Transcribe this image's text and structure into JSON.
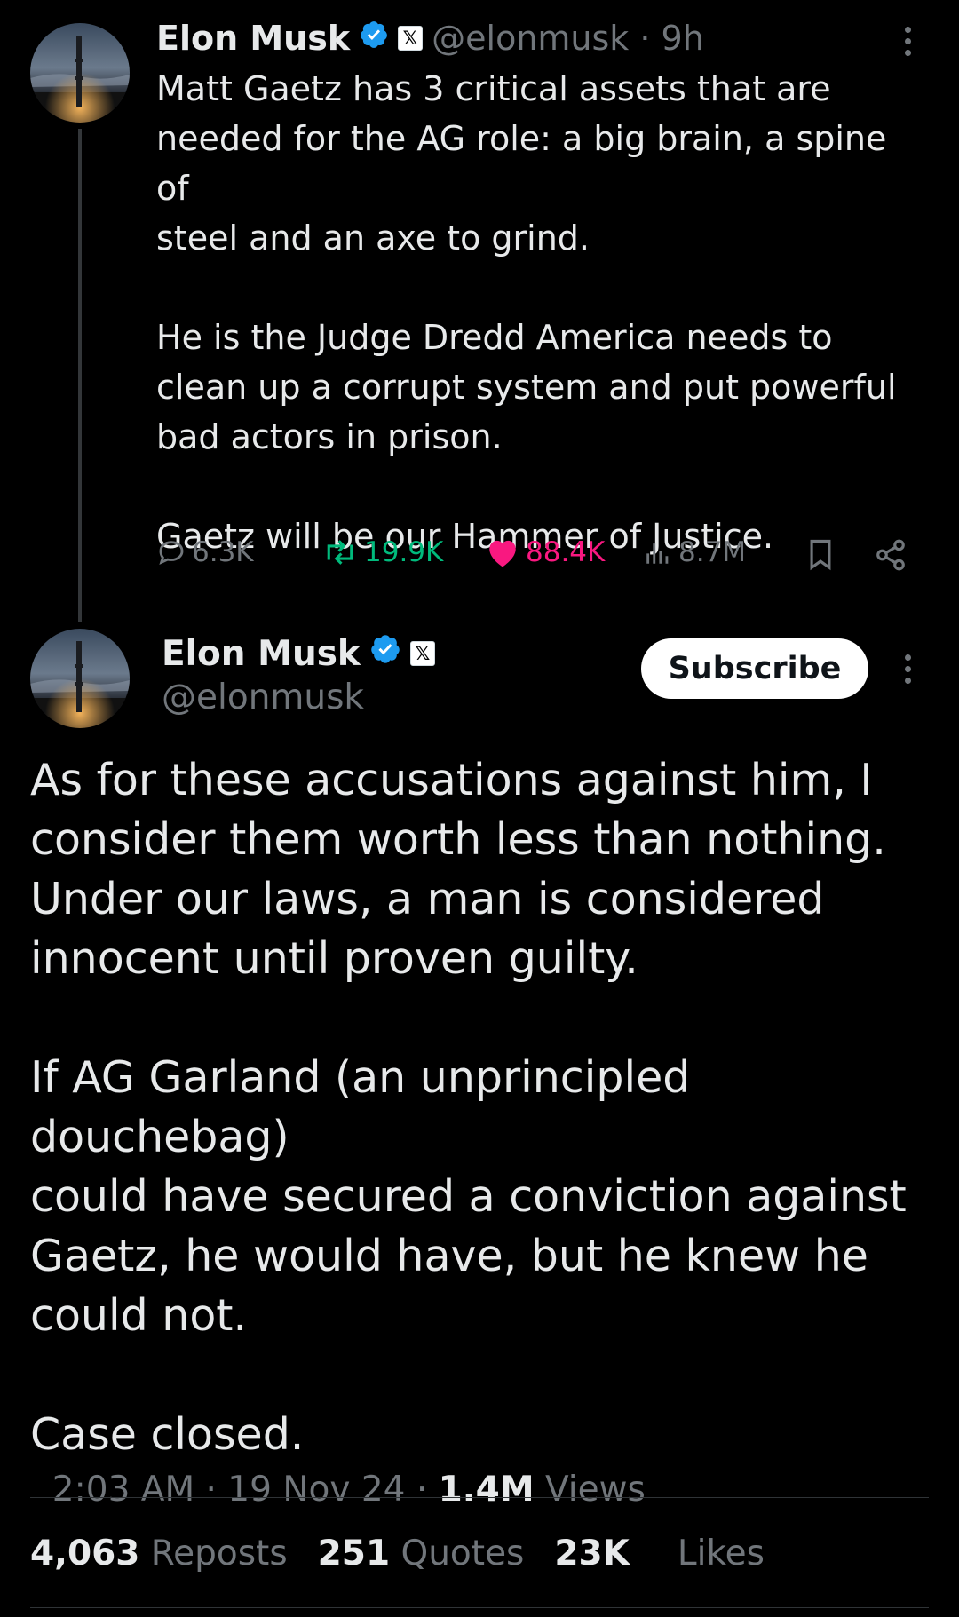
{
  "first_tweet": {
    "author_name": "Elon Musk",
    "handle_time": "@elonmusk · 9h",
    "text": "Matt Gaetz has 3 critical assets that are\nneeded for the AG role: a big brain, a spine of\nsteel and an axe to grind.\n\nHe is the Judge Dredd America needs to\nclean up a corrupt system and put powerful\nbad actors in prison.\n\nGaetz will be our Hammer of Justice.",
    "replies": "6.3K",
    "reposts": "19.9K",
    "likes": "88.4K",
    "views": "8.7M"
  },
  "main_tweet": {
    "author_name": "Elon Musk",
    "handle": "@elonmusk",
    "subscribe_label": "Subscribe",
    "text": "As for these accusations against him, I\nconsider them worth less than nothing.\nUnder our laws, a man is considered\ninnocent until proven guilty.\n\nIf AG Garland (an unprincipled douchebag)\ncould have secured a conviction against\nGaetz, he would have, but he knew he\ncould not.\n\nCase closed.",
    "timestamp": "2:03 AM · 19 Nov 24 · ",
    "views_count": "1.4M",
    "views_label": "Views",
    "reposts_count": "4,063",
    "reposts_label": "Reposts",
    "quotes_count": "251",
    "quotes_label": "Quotes",
    "likes_count": "23K",
    "likes_label": "Likes"
  },
  "colors": {
    "background": "#000000",
    "text": "#e7e9ea",
    "muted": "#71767b",
    "verified": "#1d9bf0",
    "repost": "#00ba7c",
    "like": "#f91880"
  },
  "icons": [
    "verified-badge-icon",
    "x-affiliation-icon",
    "more-options-icon",
    "reply-icon",
    "repost-icon",
    "like-icon",
    "views-icon",
    "bookmark-icon",
    "share-icon"
  ]
}
